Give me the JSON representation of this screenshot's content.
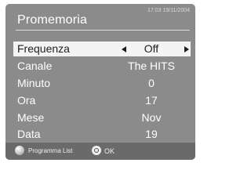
{
  "header": {
    "title": "Promemoria",
    "datetime": "17:03 19/11/2004"
  },
  "menu": {
    "rows": [
      {
        "label": "Frequenza",
        "value": "Off",
        "selected": true
      },
      {
        "label": "Canale",
        "value": "The HITS"
      },
      {
        "label": "Minuto",
        "value": "0"
      },
      {
        "label": "Ora",
        "value": "17"
      },
      {
        "label": "Mese",
        "value": "Nov"
      },
      {
        "label": "Data",
        "value": "19"
      }
    ]
  },
  "footer": {
    "programma_label": "Programma List",
    "ok_label": "OK"
  }
}
